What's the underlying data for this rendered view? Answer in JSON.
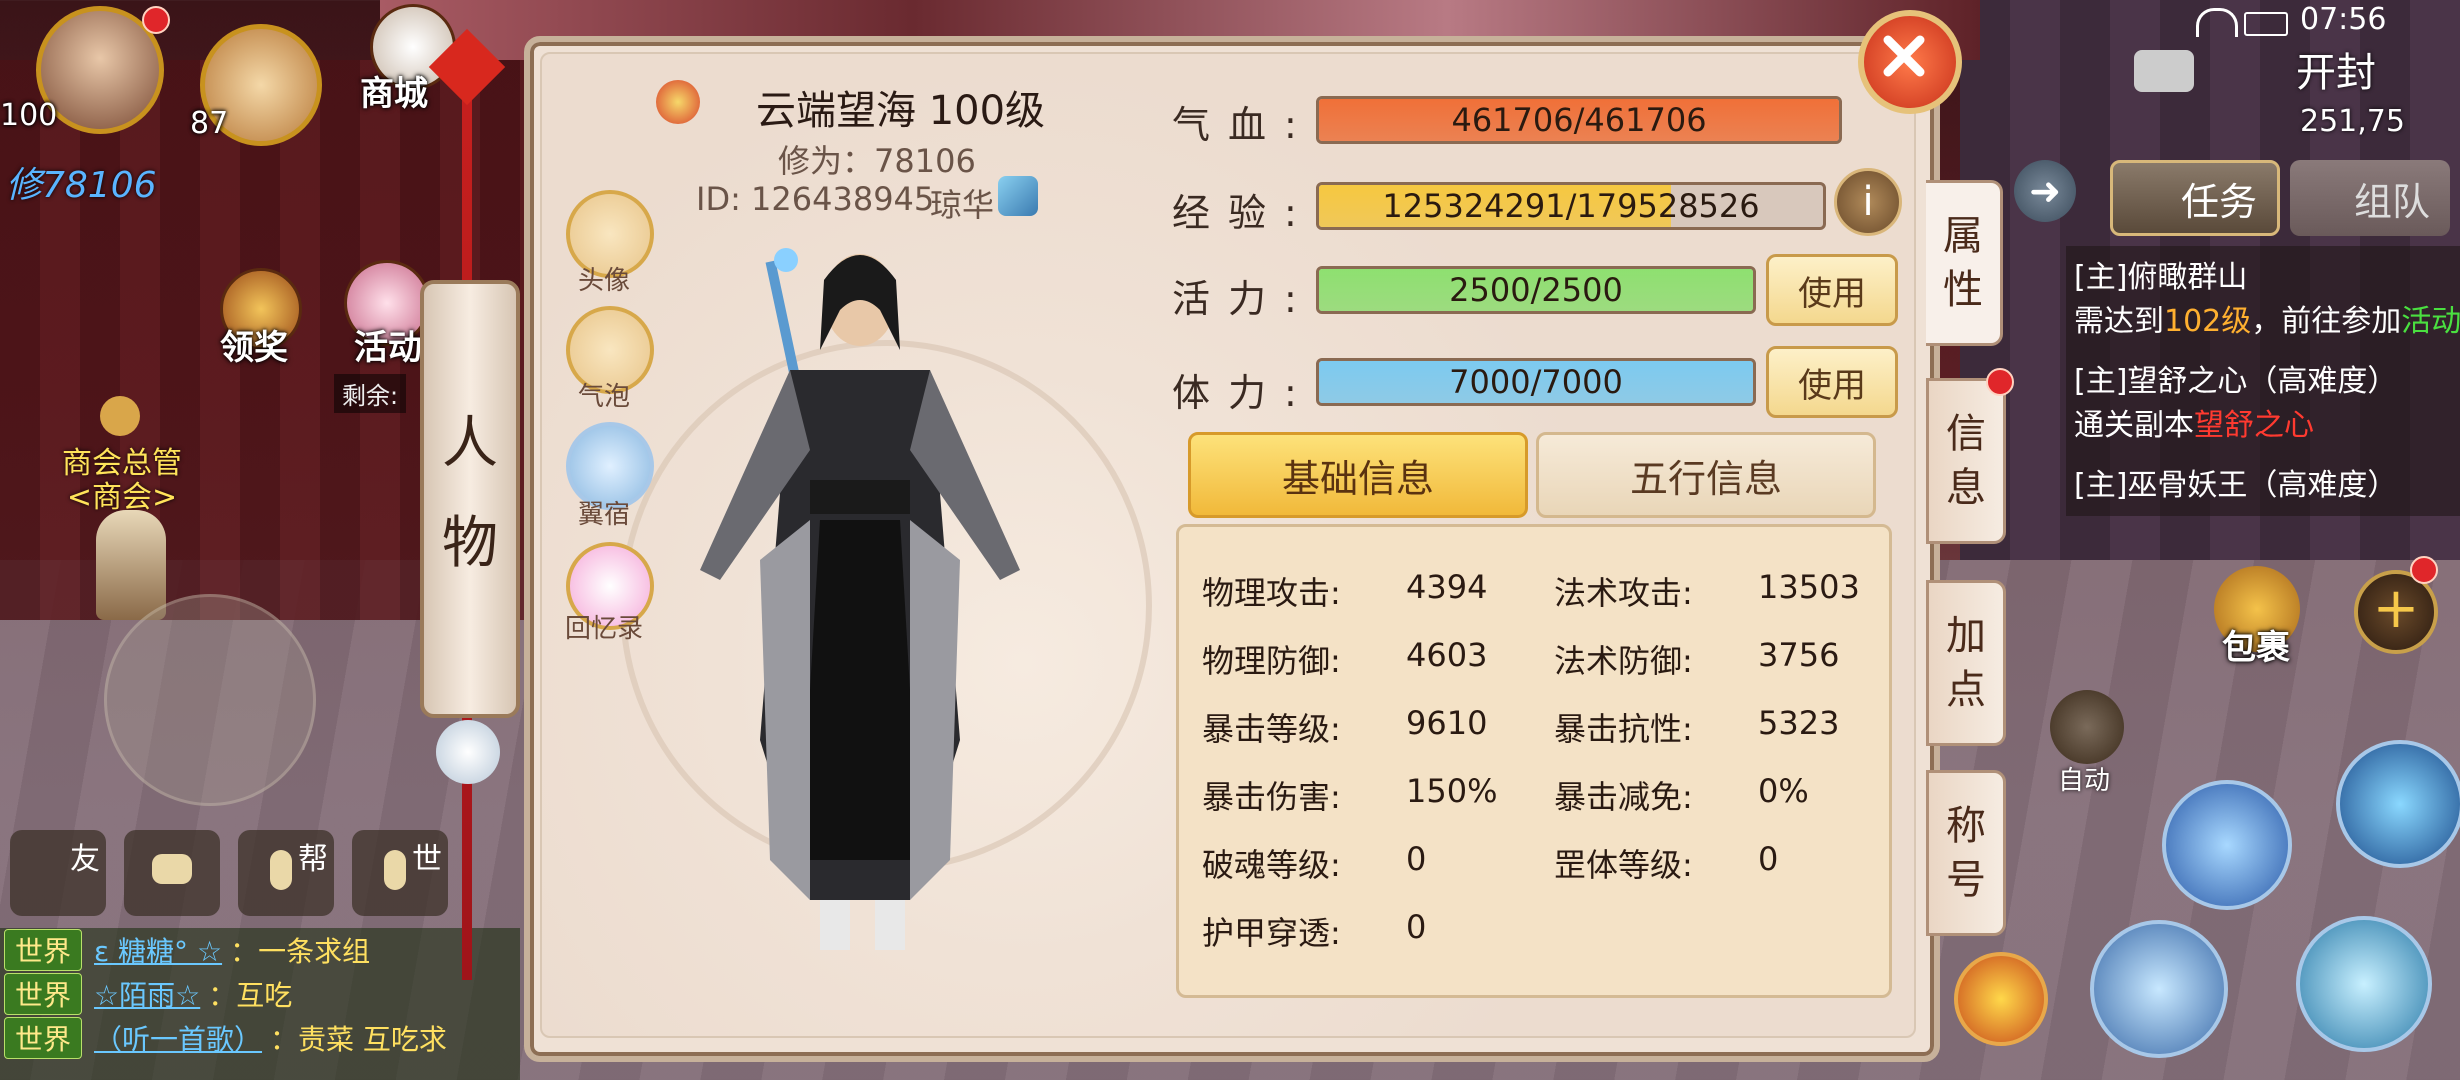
{
  "status_bar": {
    "time": "07:56"
  },
  "hud_left": {
    "player_level": "100",
    "pet_level": "87",
    "power_label": "修78106",
    "shop_label": "商城",
    "reward_label": "领奖",
    "activity_label": "活动",
    "remaining_label": "剩余:",
    "npc_name": "商会总管",
    "npc_title": "<商会>",
    "chat_buttons": [
      "友",
      "",
      "帮",
      "世"
    ]
  },
  "chat": [
    {
      "tag": "世界",
      "name": "ε 糖糖° ☆",
      "msg": "：一条求组"
    },
    {
      "tag": "世界",
      "name": "☆陌雨☆",
      "msg": "：互吃"
    },
    {
      "tag": "世界",
      "name": "（听一首歌）",
      "msg": "：责菜 互吃求"
    }
  ],
  "side_scroll": {
    "line1": "人",
    "line2": "物"
  },
  "character": {
    "name": "云端望海 100级",
    "cultivation": "修为：78106",
    "id": "ID: 126438945",
    "server": "琼华"
  },
  "side_icons": [
    "头像",
    "气泡",
    "翼宿",
    "回忆录"
  ],
  "stats": [
    {
      "label": "气血:",
      "value": "461706/461706",
      "fill": 1.0,
      "color": "#f07038",
      "button": ""
    },
    {
      "label": "经验:",
      "value": "125324291/179528526",
      "fill": 0.698,
      "color": "#f6c840",
      "button": "info"
    },
    {
      "label": "活力:",
      "value": "2500/2500",
      "fill": 1.0,
      "color": "#8ee070",
      "button": "使用"
    },
    {
      "label": "体力:",
      "value": "7000/7000",
      "fill": 1.0,
      "color": "#7ccaf0",
      "button": "使用"
    }
  ],
  "tabs": {
    "basic": "基础信息",
    "elements": "五行信息"
  },
  "attributes": [
    {
      "k1": "物理攻击:",
      "v1": "4394",
      "k2": "法术攻击:",
      "v2": "13503"
    },
    {
      "k1": "物理防御:",
      "v1": "4603",
      "k2": "法术防御:",
      "v2": "3756"
    },
    {
      "k1": "暴击等级:",
      "v1": "9610",
      "k2": "暴击抗性:",
      "v2": "5323"
    },
    {
      "k1": "暴击伤害:",
      "v1": "150%",
      "k2": "暴击减免:",
      "v2": "0%"
    },
    {
      "k1": "破魂等级:",
      "v1": "0",
      "k2": "罡体等级:",
      "v2": "0"
    },
    {
      "k1": "护甲穿透:",
      "v1": "0",
      "k2": "",
      "v2": ""
    }
  ],
  "vertical_tabs": [
    {
      "l1": "属",
      "l2": "性"
    },
    {
      "l1": "信",
      "l2": "息"
    },
    {
      "l1": "加",
      "l2": "点"
    },
    {
      "l1": "称",
      "l2": "号"
    }
  ],
  "hud_right": {
    "location": "开封",
    "coords": "251,75",
    "task_label": "任务",
    "team_label": "组队",
    "quests": [
      {
        "line1": "[主]俯瞰群山",
        "line2a": "需达到",
        "line2b": "102级",
        "line2c": "，前往参加",
        "line2d": "活动"
      },
      {
        "line1": "[主]望舒之心（高难度）",
        "line2a": "通关副本",
        "line2b": "望舒之心"
      },
      {
        "line1": "[主]巫骨妖王（高难度）"
      }
    ],
    "bag_label": "包裹",
    "auto_label": "自动"
  }
}
